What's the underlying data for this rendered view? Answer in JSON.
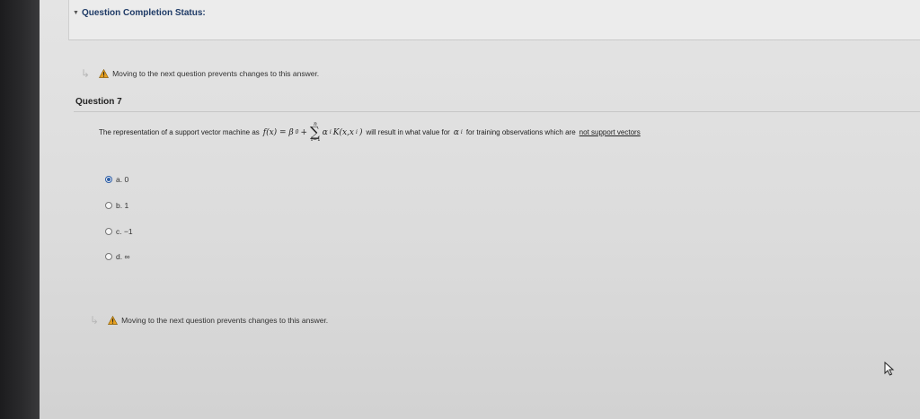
{
  "status": {
    "title": "Question Completion Status:"
  },
  "warnings": {
    "top": "Moving to the next question prevents changes to this answer.",
    "bottom": "Moving to the next question prevents changes to this answer."
  },
  "question": {
    "title": "Question 7",
    "text_before": "The representation of a support vector machine as",
    "formula_lhs": "f(x) = β",
    "formula_sub0": "0",
    "formula_plus": "+",
    "sigma_symbol": "∑",
    "sigma_top": "n",
    "sigma_bottom": "i=1",
    "formula_alpha": "α",
    "formula_sub_i": "i",
    "formula_kernel": "K(x,x",
    "formula_close": ")",
    "text_middle": "will result in what value for",
    "alpha_symbol": "α",
    "alpha_sub": "i",
    "text_for": "for training observations which are",
    "text_underlined": "not support vectors"
  },
  "options": [
    {
      "label": "a. 0",
      "selected": true
    },
    {
      "label": "b. 1",
      "selected": false
    },
    {
      "label": "c. −1",
      "selected": false
    },
    {
      "label": "d. ∞",
      "selected": false
    }
  ],
  "icons": {
    "warning": "warning-triangle-icon",
    "arrow": "indent-arrow-icon",
    "cursor": "mouse-pointer-icon"
  },
  "colors": {
    "accent": "#2e5fa8",
    "title": "#1e3a66",
    "warning": "#e6a020"
  }
}
